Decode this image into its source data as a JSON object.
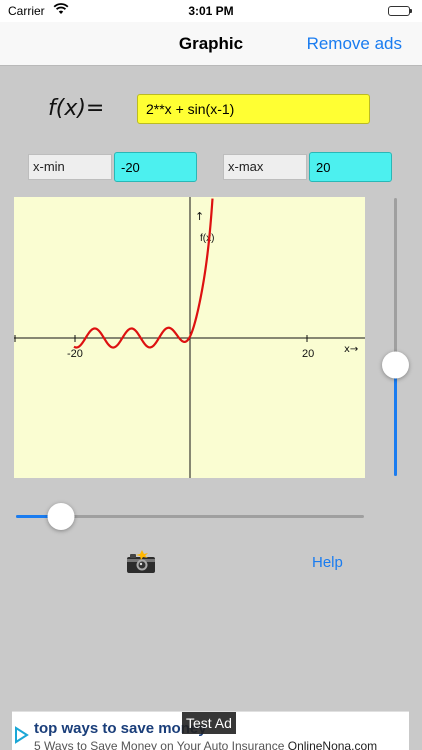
{
  "status_bar": {
    "carrier": "Carrier",
    "time": "3:01 PM"
  },
  "nav": {
    "title": "Graphic",
    "remove_ads_label": "Remove ads"
  },
  "formula": {
    "label": "f(x)=",
    "value": "2**x + sin(x-1)"
  },
  "range": {
    "xmin_label": "x-min",
    "xmin_value": "-20",
    "xmax_label": "x-max",
    "xmax_value": "20"
  },
  "plot": {
    "x_tick_left": "-20",
    "x_tick_right": "20",
    "x_axis_label": "x→",
    "y_axis_arrow": "↑",
    "y_axis_label": "f(x)",
    "background_color": "#fafdd2",
    "curve_color": "#dd1111",
    "axis_color": "#111111"
  },
  "controls": {
    "horizontal_slider_value": 0.13,
    "vertical_slider_value": 0.4,
    "help_label": "Help",
    "camera_icon": "camera-flash-icon"
  },
  "ad": {
    "title": "top ways to save money",
    "subtitle": "5 Ways to Save Money on Your Auto Insurance",
    "brand": "OnlineNona.com",
    "badge": "Test Ad"
  },
  "colors": {
    "accent": "#1a7cf0",
    "formula_bg": "#ffff33",
    "range_input_bg": "#4cf0ef",
    "page_bg": "#c9c9c9"
  }
}
